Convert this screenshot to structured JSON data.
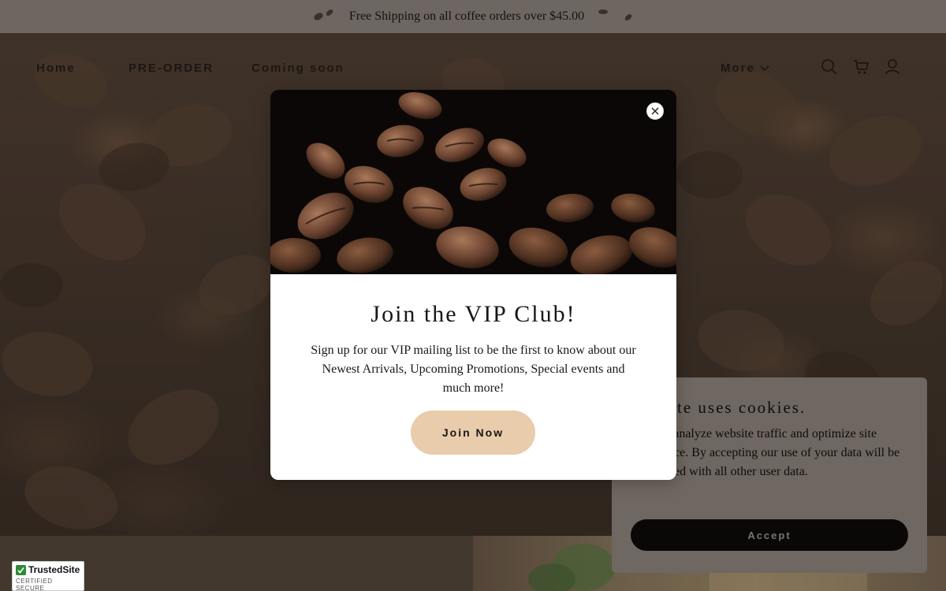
{
  "announcement": {
    "text": "Free Shipping on all coffee orders over $45.00"
  },
  "nav": {
    "items": [
      {
        "label": "Home"
      },
      {
        "label": "PRE-ORDER"
      },
      {
        "label": "Coming soon"
      }
    ],
    "more_label": "More",
    "icons": [
      "search-icon",
      "cart-icon",
      "account-icon"
    ]
  },
  "modal": {
    "title": "Join the VIP Club!",
    "text": "Sign up for our VIP mailing list to be the first to know about our Newest Arrivals, Upcoming Promotions, Special events and much more!",
    "join_label": "Join Now",
    "close_icon": "close-icon"
  },
  "cookie": {
    "title": "website uses cookies.",
    "body": "okies to analyze website traffic and optimize site experience. By accepting our use of your data will be aggregated with all other user data.",
    "accept_label": "Accept"
  },
  "badge": {
    "name": "TrustedSite",
    "subtitle": "CERTIFIED SECURE"
  },
  "colors": {
    "announcement_bg": "#6e6660",
    "join_button": "#e8ccab",
    "accept_button": "#0a0807"
  }
}
